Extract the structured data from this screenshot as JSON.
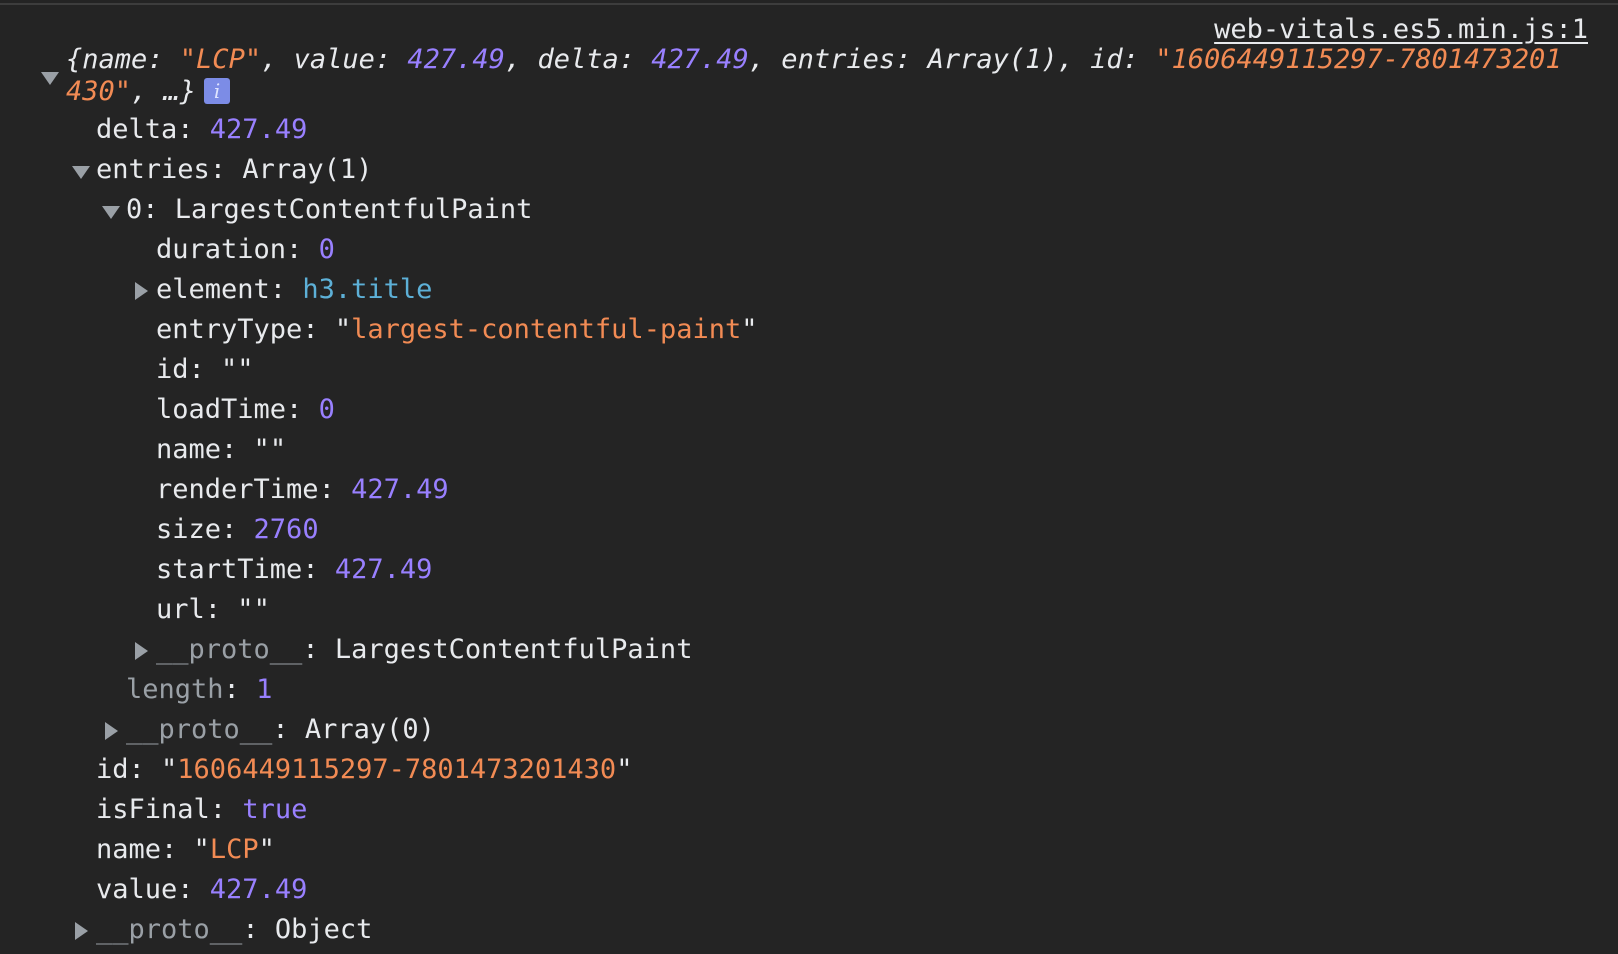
{
  "source_link": "web-vitals.es5.min.js:1",
  "summary": {
    "line1_pre": "{name: ",
    "name_val": "\"LCP\"",
    "sep1": ", value: ",
    "value_val": "427.49",
    "sep2": ", delta: ",
    "delta_val": "427.49",
    "sep3": ", entries: Array(1), id: ",
    "id_part1": "\"1606449115297-7801473201",
    "id_part2": "430\"",
    "line2_rest": ", …}",
    "info_label": "i"
  },
  "root": {
    "delta": {
      "key": "delta",
      "value": "427.49"
    },
    "entries": {
      "key": "entries",
      "value": "Array(1)"
    },
    "id": {
      "key": "id",
      "value": "1606449115297-7801473201430"
    },
    "isFinal": {
      "key": "isFinal",
      "value": "true"
    },
    "name": {
      "key": "name",
      "value": "LCP"
    },
    "value": {
      "key": "value",
      "value": "427.49"
    },
    "proto": {
      "key": "__proto__",
      "value": "Object"
    }
  },
  "entries": {
    "item0": {
      "key": "0",
      "value": "LargestContentfulPaint"
    },
    "length": {
      "key": "length",
      "value": "1"
    },
    "proto": {
      "key": "__proto__",
      "value": "Array(0)"
    }
  },
  "lcp": {
    "duration": {
      "key": "duration",
      "value": "0"
    },
    "element": {
      "key": "element",
      "value": "h3.title"
    },
    "entryType": {
      "key": "entryType",
      "value": "largest-contentful-paint"
    },
    "id": {
      "key": "id",
      "value": ""
    },
    "loadTime": {
      "key": "loadTime",
      "value": "0"
    },
    "name": {
      "key": "name",
      "value": ""
    },
    "renderTime": {
      "key": "renderTime",
      "value": "427.49"
    },
    "size": {
      "key": "size",
      "value": "2760"
    },
    "startTime": {
      "key": "startTime",
      "value": "427.49"
    },
    "url": {
      "key": "url",
      "value": ""
    },
    "proto": {
      "key": "__proto__",
      "value": "LargestContentfulPaint"
    }
  },
  "colors": {
    "background": "#242424",
    "key": "#e8eaed",
    "number": "#9980ff",
    "string": "#f28b54",
    "node": "#5db0d7",
    "dim_key": "#9aa0a6"
  }
}
